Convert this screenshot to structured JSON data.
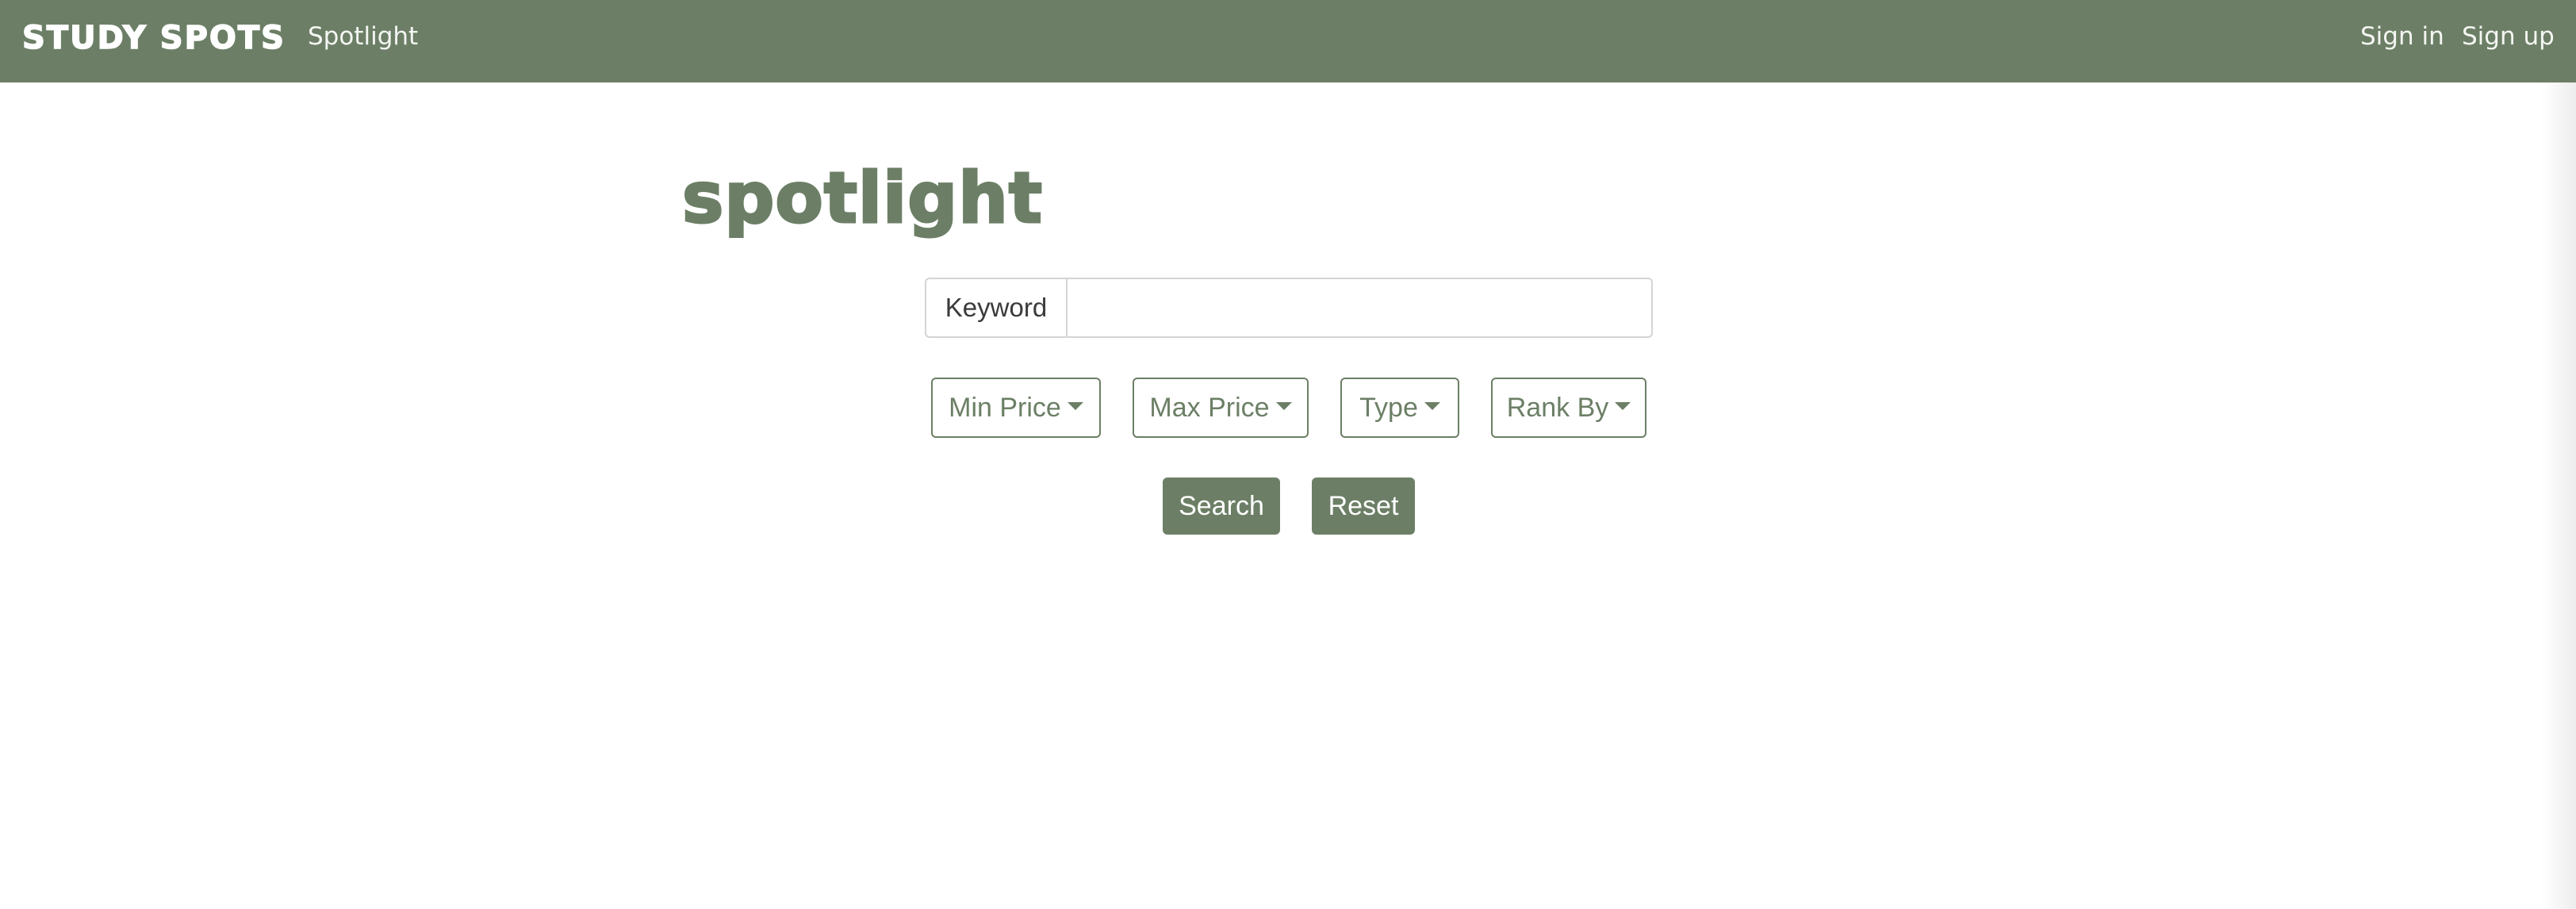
{
  "navbar": {
    "brand": "STUDY SPOTS",
    "spotlight_link": "Spotlight",
    "sign_in": "Sign in",
    "sign_up": "Sign up"
  },
  "main": {
    "headline": "spotlight",
    "keyword_label": "Keyword",
    "keyword_value": "",
    "filters": {
      "min_price": "Min Price",
      "max_price": "Max Price",
      "type": "Type",
      "rank_by": "Rank By"
    },
    "search_label": "Search",
    "reset_label": "Reset"
  },
  "colors": {
    "brand": "#6c7f66",
    "text_on_brand": "#ffffff",
    "background": "#ffffff"
  }
}
